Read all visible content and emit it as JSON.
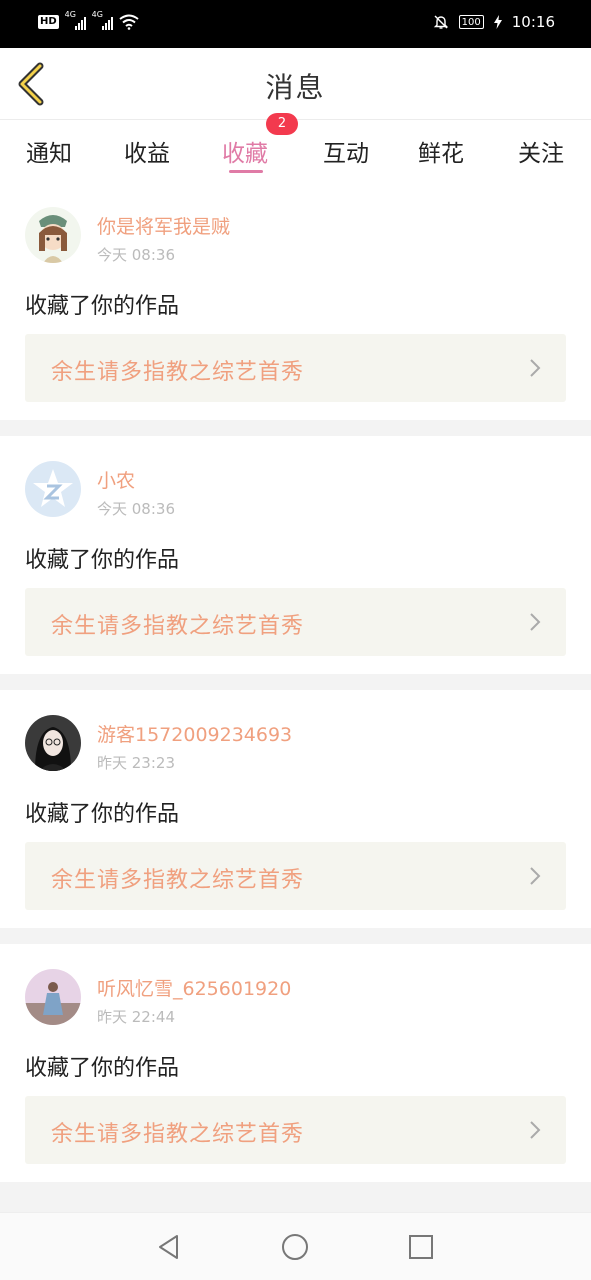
{
  "status_bar": {
    "hd": "HD",
    "net1": "4G",
    "net2": "4G",
    "battery": "100",
    "time": "10:16"
  },
  "header": {
    "title": "消息",
    "back_icon": "chevron-left-icon"
  },
  "tabs": [
    {
      "label": "通知",
      "active": false
    },
    {
      "label": "收益",
      "active": false
    },
    {
      "label": "收藏",
      "active": true,
      "badge": "2"
    },
    {
      "label": "互动",
      "active": false
    },
    {
      "label": "鲜花",
      "active": false
    },
    {
      "label": "关注",
      "active": false
    }
  ],
  "messages": [
    {
      "user": "你是将军我是贼",
      "time": "今天 08:36",
      "action": "收藏了你的作品",
      "work": "余生请多指教之综艺首秀"
    },
    {
      "user": "小农",
      "time": "今天 08:36",
      "action": "收藏了你的作品",
      "work": "余生请多指教之综艺首秀"
    },
    {
      "user": "游客1572009234693",
      "time": "昨天 23:23",
      "action": "收藏了你的作品",
      "work": "余生请多指教之综艺首秀"
    },
    {
      "user": "听风忆雪_625601920",
      "time": "昨天 22:44",
      "action": "收藏了你的作品",
      "work": "余生请多指教之综艺首秀"
    }
  ],
  "colors": {
    "accent": "#e07ba6",
    "username": "#f0a07f",
    "badge": "#f33a4e",
    "work_bg": "#f5f5ef"
  }
}
